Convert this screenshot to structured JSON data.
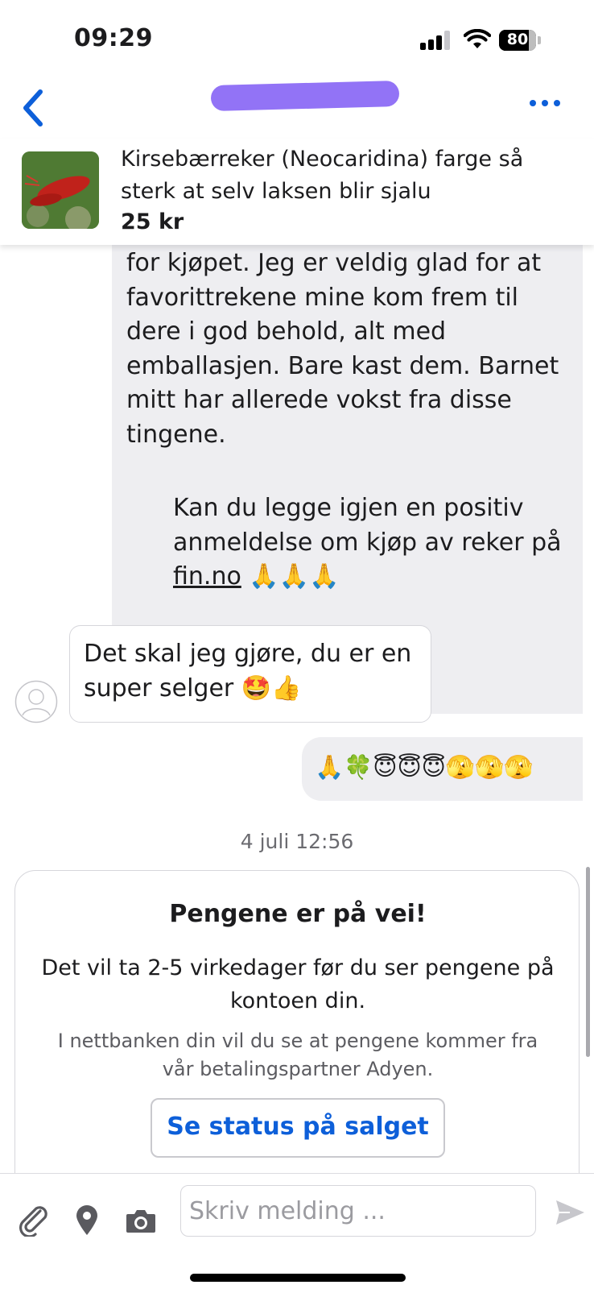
{
  "status_bar": {
    "time": "09:29",
    "battery_percent": "80",
    "battery_level": 0.8,
    "icons": [
      "signal-icon",
      "wifi-icon",
      "battery-icon"
    ]
  },
  "nav": {
    "back_icon": "chevron-left-icon",
    "more_icon": "more-dots-icon",
    "accent_color": "#0d5fd9",
    "name_redaction_color": "#8c6cf5"
  },
  "item": {
    "title": "Kirsebærreker (Neocaridina) farge så sterk at selv laksen blir sjalu",
    "price": "25 kr"
  },
  "messages": [
    {
      "side": "right",
      "text": "for kjøpet. Jeg er veldig glad for at\nfavorittrekene mine kom frem til\ndere i god behold, alt med\nemballasjen. Bare kast dem. Barnet\nmitt har allerede vokst fra disse\ntingene."
    },
    {
      "side": "right",
      "text_before_link": "Kan du legge igjen en positiv\nanmeldelse om kjøp av reker på\n",
      "link": "fin.no",
      "text_after_link": " 🙏🙏🙏"
    },
    {
      "side": "left",
      "text": "Det skal jeg gjøre, du er en\nsuper selger 🤩👍"
    },
    {
      "side": "right",
      "text": "🙏🍀😇😇😇🫣🫣🫣"
    }
  ],
  "timestamp": "4 juli 12:56",
  "payment_card": {
    "title": "Pengene er på vei!",
    "body": "Det vil ta 2-5 virkedager før du ser pengene på\nkontoen din.",
    "note": "I nettbanken din vil du se at pengene kommer fra\nvår betalingspartner Adyen.",
    "button": "Se status på salget"
  },
  "composer": {
    "placeholder": "Skriv melding ...",
    "icons": [
      "paperclip-icon",
      "location-pin-icon",
      "camera-icon",
      "send-icon"
    ]
  }
}
